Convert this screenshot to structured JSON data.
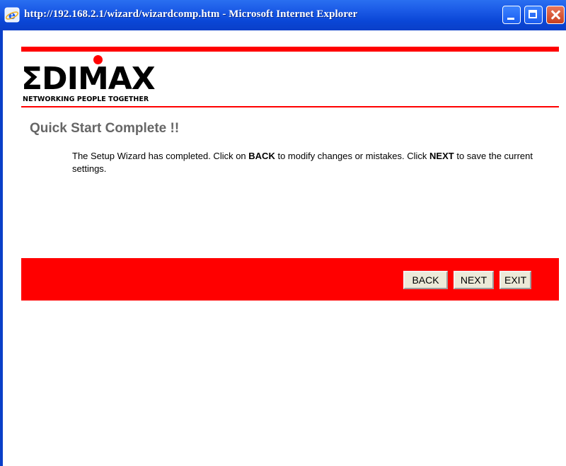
{
  "window": {
    "title": "http://192.168.2.1/wizard/wizardcomp.htm - Microsoft Internet Explorer",
    "buttons": [
      "minimize",
      "maximize",
      "close"
    ]
  },
  "logo": {
    "wordmark": "EDIMAX",
    "wordmark_display": "ΣDIMAX",
    "tagline": "NETWORKING PEOPLE TOGETHER"
  },
  "page": {
    "heading": "Quick Start Complete !!",
    "message": {
      "part1": "The Setup Wizard has completed. Click on ",
      "back_word": "BACK",
      "part2": " to modify changes or mistakes. Click ",
      "next_word": "NEXT",
      "part3": " to save the current settings."
    }
  },
  "actions": {
    "back_label": "BACK",
    "next_label": "NEXT",
    "exit_label": "EXIT"
  },
  "colors": {
    "brand_red": "#ff0000",
    "heading_gray": "#666666",
    "titlebar_blue": "#0a46d6"
  }
}
